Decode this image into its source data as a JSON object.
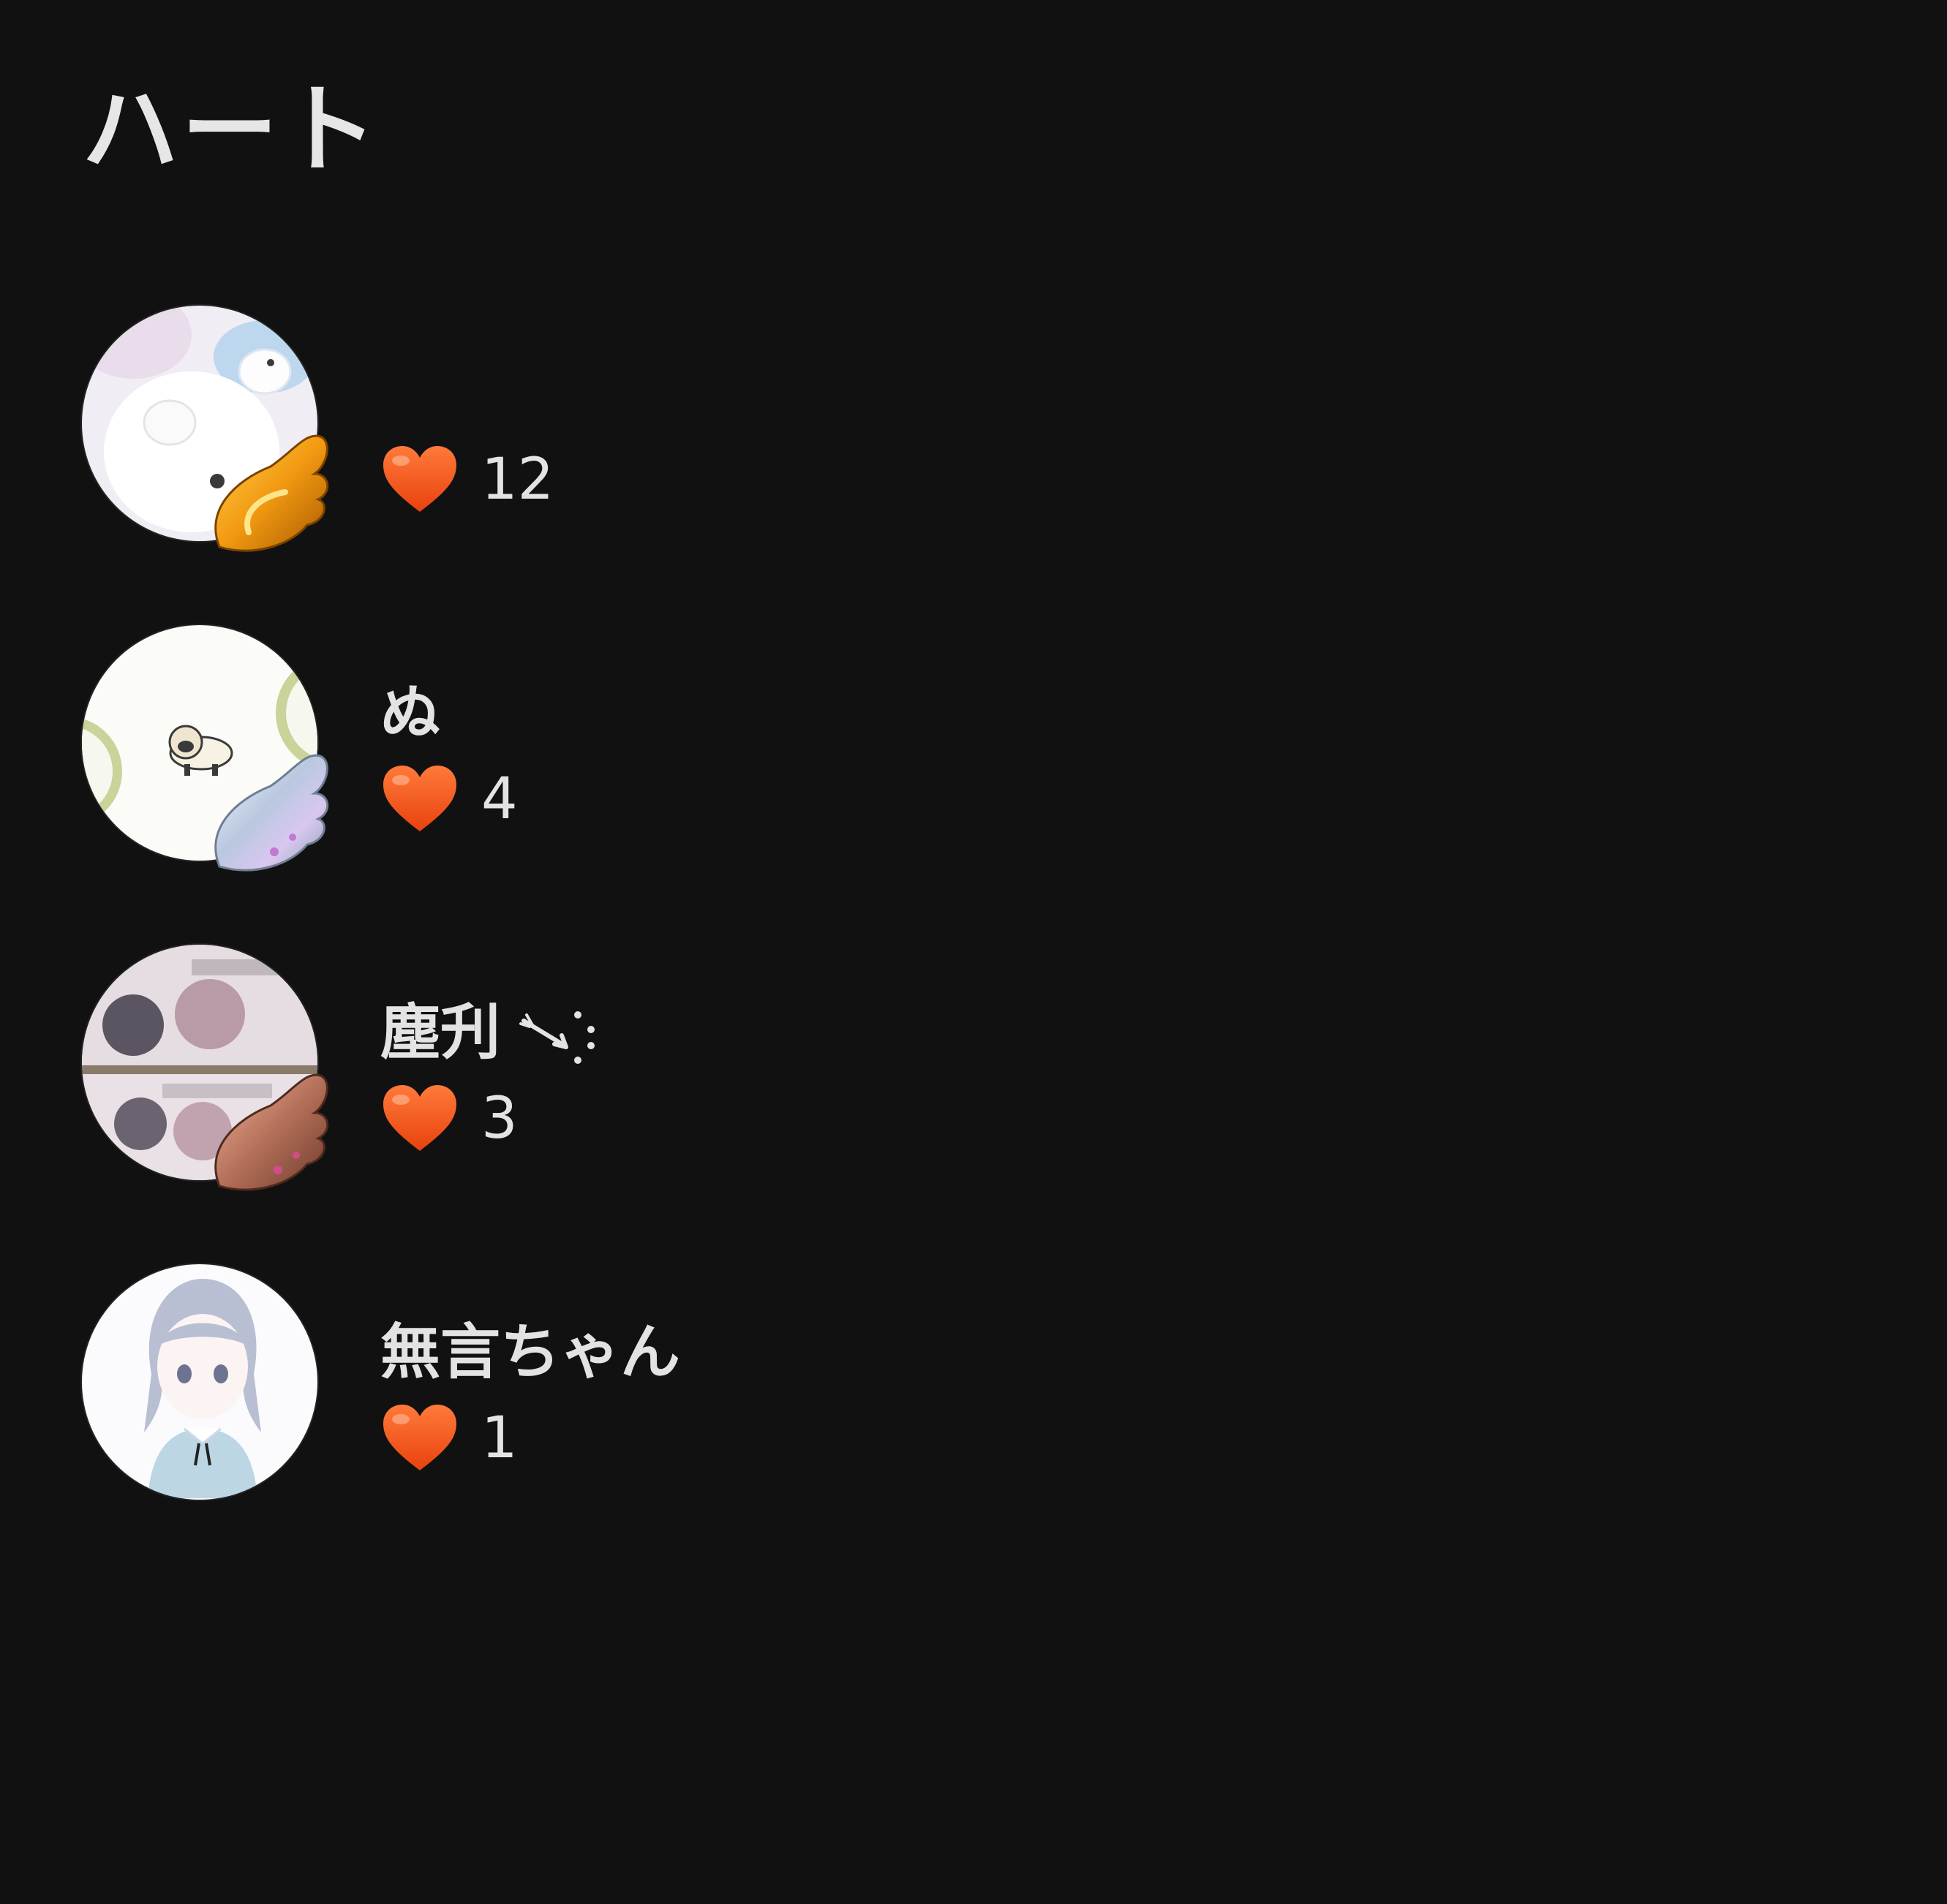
{
  "header": {
    "title": "ハート"
  },
  "users": [
    {
      "name": "",
      "hearts": "12",
      "badge": "gold-wing",
      "avatar": "bunny-illustration"
    },
    {
      "name": "ぬ",
      "hearts": "4",
      "badge": "silver-wing",
      "avatar": "pug-illustration"
    },
    {
      "name": "塵刋",
      "name_decoration": "sparkle-arrow-icon",
      "hearts": "3",
      "badge": "bronze-wing",
      "avatar": "anime-collage"
    },
    {
      "name": "無言ちゃん",
      "hearts": "1",
      "badge": "",
      "avatar": "anime-girl-illustration"
    }
  ],
  "colors": {
    "background": "#111111",
    "text": "#e3e3e3",
    "heart": "#ff5a1f"
  }
}
